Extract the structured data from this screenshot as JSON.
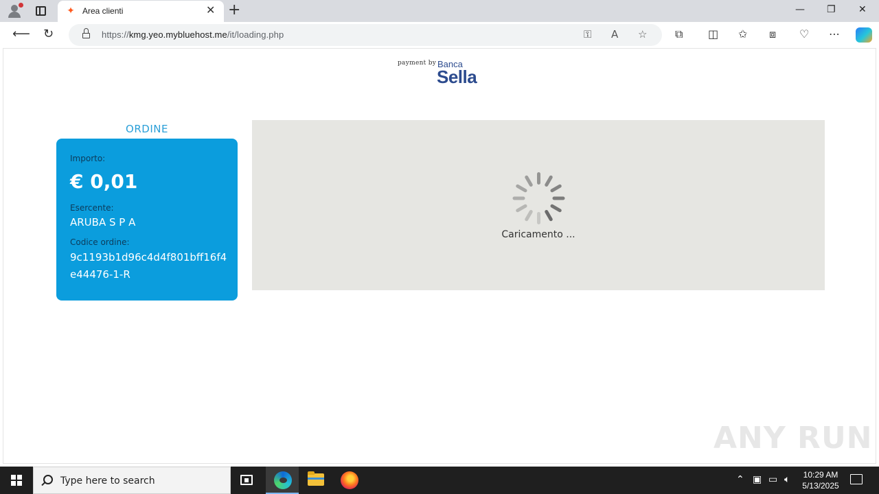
{
  "browser": {
    "tab_title": "Area clienti",
    "url_protocol": "https://",
    "url_host": "kmg.yeo.mybluehost.me",
    "url_path": "/it/loading.php"
  },
  "page": {
    "brand": {
      "payment_by": "payment by",
      "banca": "Banca",
      "sella": "Sella"
    },
    "order": {
      "title": "ORDINE",
      "amount_label": "Importo:",
      "amount_value": "€ 0,01",
      "merchant_label": "Esercente:",
      "merchant_value": "ARUBA S P A",
      "order_code_label": "Codice ordine:",
      "order_code_value": "9c1193b1d96c4d4f801bff16f4e44476-1-R"
    },
    "loading_text": "Caricamento ...",
    "watermark": "ANY RUN"
  },
  "taskbar": {
    "search_placeholder": "Type here to search",
    "time": "10:29 AM",
    "date": "5/13/2025"
  },
  "colors": {
    "order_card": "#0b9ddd",
    "order_title": "#2a9fd8",
    "brand_blue": "#2c4b8e",
    "loader_panel": "#e6e6e2"
  }
}
